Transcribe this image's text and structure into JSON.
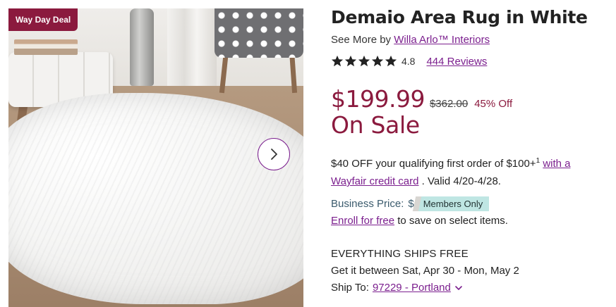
{
  "badge": {
    "label": "Way Day Deal"
  },
  "product": {
    "title": "Demaio Area Rug in White",
    "see_more_prefix": "See More by",
    "brand": "Willa Arlo™ Interiors",
    "rating": "4.8",
    "stars": 5,
    "reviews": "444 Reviews"
  },
  "pricing": {
    "price": "$199.99",
    "old_price": "$362.00",
    "discount": "45% Off",
    "sale_label": "On Sale"
  },
  "promo": {
    "text_before": "$40 OFF your qualifying first order of $100+",
    "sup": "1",
    "link_text": "with a Wayfair credit card",
    "text_after": ". Valid 4/20-4/28."
  },
  "business": {
    "label": "Business Price:",
    "dollar": "$",
    "members_only": "Members Only",
    "enroll_link": "Enroll for free",
    "enroll_text": "to save on select items."
  },
  "shipping": {
    "headline": "EVERYTHING SHIPS FREE",
    "delivery": "Get it between Sat, Apr 30 - Mon, May 2",
    "ship_to_label": "Ship To:",
    "zip": "97229 - Portland"
  },
  "colors": {
    "accent": "#7b1f8e",
    "sale": "#8b1a3e",
    "members_bg": "#bfe6e3"
  },
  "icons": {
    "next": "chevron-right-icon",
    "star": "star-icon",
    "dropdown": "chevron-down-icon"
  }
}
